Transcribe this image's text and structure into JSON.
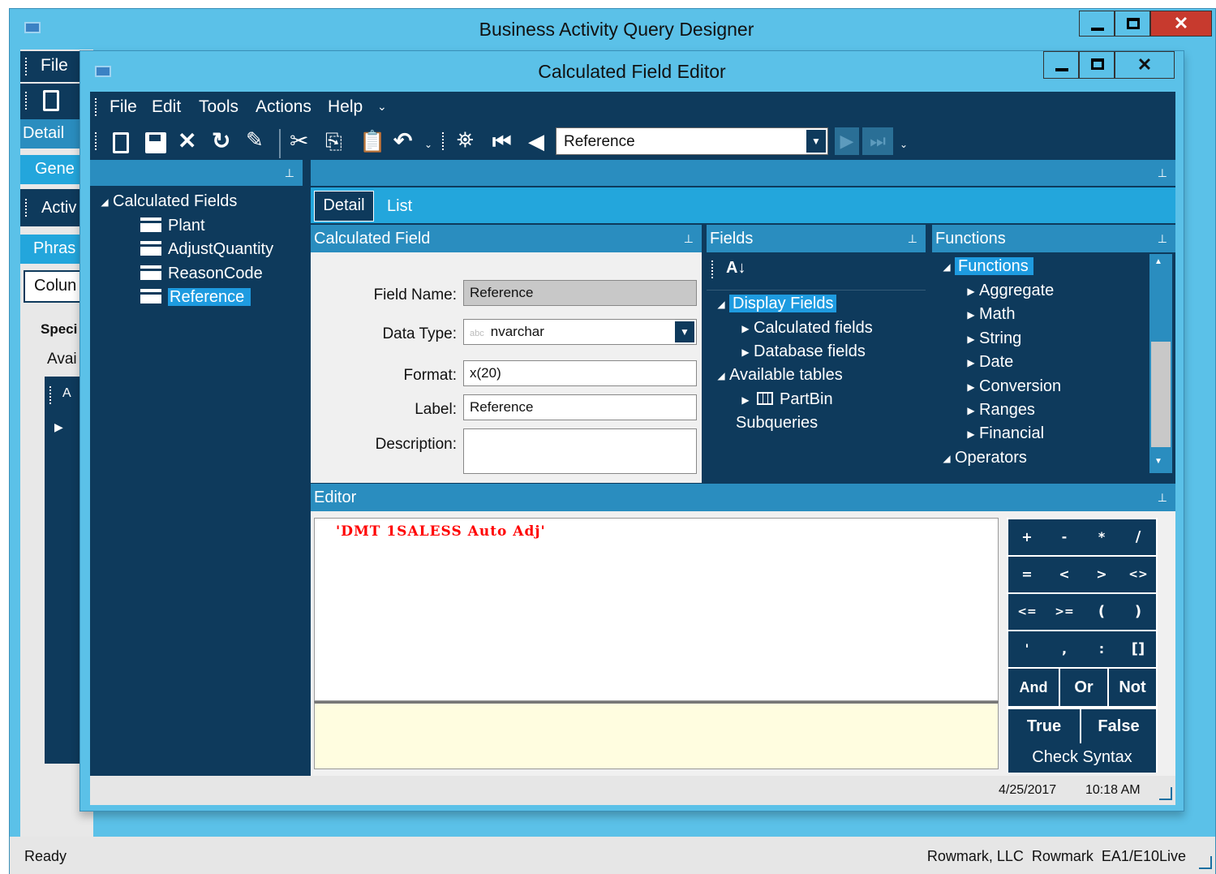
{
  "outer_window": {
    "title": "Business Activity Query Designer",
    "menu": [
      "File"
    ],
    "left_tabs": [
      "Detail",
      "Gene",
      "Activ",
      "Phras",
      "Colun"
    ],
    "left_text": [
      "Speci",
      "Avai"
    ],
    "status_left": "Ready",
    "status_right": "Rowmark, LLC  Rowmark  EA1/E10Live"
  },
  "inner_window": {
    "title": "Calculated Field Editor",
    "menu": [
      "File",
      "Edit",
      "Tools",
      "Actions",
      "Help"
    ],
    "toolbar_combo_value": "Reference",
    "tree": {
      "root": "Calculated Fields",
      "items": [
        "Plant",
        "AdjustQuantity",
        "ReasonCode",
        "Reference"
      ],
      "selected": "Reference"
    },
    "tabs": [
      "Detail",
      "List"
    ],
    "calculated_field": {
      "header": "Calculated Field",
      "field_name_label": "Field Name:",
      "field_name_value": "Reference",
      "data_type_label": "Data Type:",
      "data_type_prefix": "abc",
      "data_type_value": "nvarchar",
      "format_label": "Format:",
      "format_value": "x(20)",
      "label_label": "Label:",
      "label_value": "Reference",
      "description_label": "Description:",
      "description_value": ""
    },
    "fields": {
      "header": "Fields",
      "display_fields": "Display Fields",
      "calculated_fields": "Calculated fields",
      "database_fields": "Database fields",
      "available_tables": "Available tables",
      "partbin": "PartBin",
      "subqueries": "Subqueries"
    },
    "functions": {
      "header": "Functions",
      "root": "Functions",
      "items": [
        "Aggregate",
        "Math",
        "String",
        "Date",
        "Conversion",
        "Ranges",
        "Financial"
      ],
      "operators": "Operators"
    },
    "editor": {
      "header": "Editor",
      "code": "'DMT 1SALESS Auto Adj'"
    },
    "keypad": {
      "row1": [
        "+",
        "-",
        "*",
        "/"
      ],
      "row2": [
        "=",
        "<",
        ">",
        "<>"
      ],
      "row3": [
        "<=",
        ">=",
        "(",
        ")"
      ],
      "row4": [
        "'",
        ",",
        ":",
        "[]"
      ],
      "row5": [
        "And",
        "Or",
        "Not"
      ],
      "row6": [
        "True",
        "False"
      ],
      "check_syntax": "Check Syntax"
    },
    "status_date": "4/25/2017",
    "status_time": "10:18 AM"
  },
  "colors": {
    "title_bar": "#5bc1e8",
    "dark_navy": "#0e3a5c",
    "pane_header": "#2a8dbf",
    "tab_bar": "#23a6dc",
    "selection": "#1e9be0",
    "code_red": "#ff0000",
    "editor_bottom": "#fffde0"
  }
}
